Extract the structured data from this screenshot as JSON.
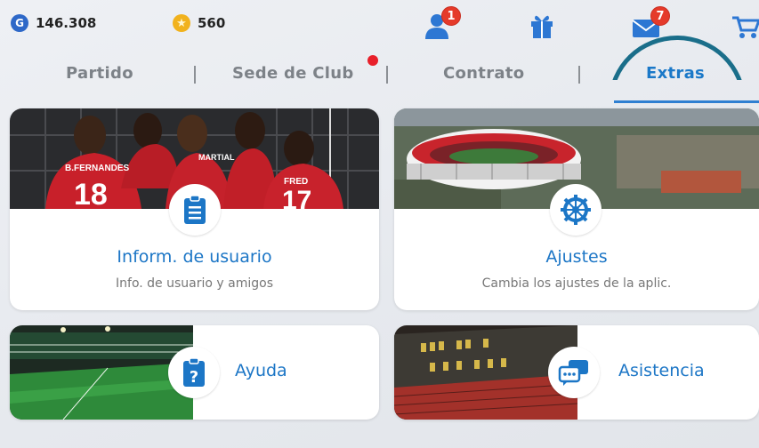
{
  "currency": {
    "gp_symbol": "G",
    "gp_value": "146.308",
    "coins_symbol": "★",
    "coins_value": "560"
  },
  "notifications": {
    "friends_count": "1",
    "mail_count": "7"
  },
  "tabs": [
    {
      "label": "Partido"
    },
    {
      "label": "Sede de Club"
    },
    {
      "label": "Contrato"
    },
    {
      "label": "Extras"
    }
  ],
  "cards": {
    "user_info": {
      "title": "Inform. de usuario",
      "subtitle": "Info. de usuario y amigos"
    },
    "settings": {
      "title": "Ajustes",
      "subtitle": "Cambia los ajustes de la aplic."
    },
    "help": {
      "title": "Ayuda"
    },
    "support": {
      "title": "Asistencia"
    }
  },
  "jerseys": {
    "player1": "B.FERNANDES",
    "number1": "18",
    "player2": "MARTIAL",
    "player3": "FRED",
    "number3": "17"
  },
  "colors": {
    "accent": "#1c76c6",
    "badge": "#e53a2a",
    "active_tab": "#1a78c8"
  },
  "icons": [
    "friends-icon",
    "gift-icon",
    "mail-icon",
    "cart-icon",
    "document-icon",
    "gear-icon",
    "help-icon",
    "chat-icon"
  ]
}
